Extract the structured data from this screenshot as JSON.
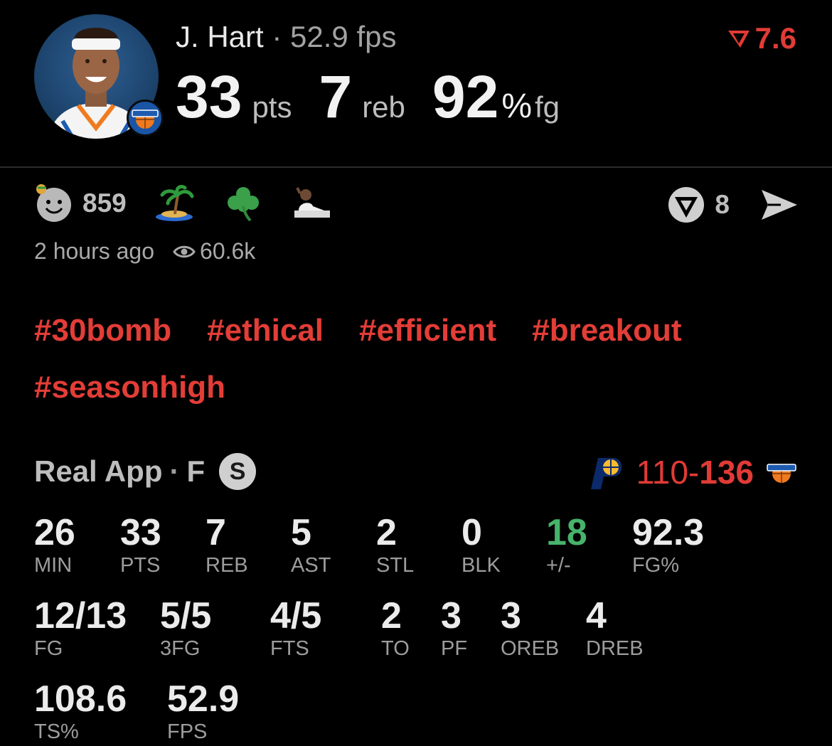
{
  "header": {
    "player_name": "J. Hart",
    "separator": "·",
    "fps_text": "52.9 fps",
    "rating": "7.6",
    "headline": [
      {
        "value": "33",
        "unit": "pts"
      },
      {
        "value": "7",
        "unit": "reb"
      },
      {
        "value": "92",
        "pct": "%",
        "unit": "fg"
      }
    ]
  },
  "reactions": {
    "count": "859",
    "comment_count": "8"
  },
  "meta": {
    "time_ago": "2 hours ago",
    "views": "60.6k"
  },
  "tags": [
    "#30bomb",
    "#ethical",
    "#efficient",
    "#breakout",
    "#seasonhigh"
  ],
  "game": {
    "source": "Real App",
    "dot": "·",
    "status": "F",
    "badge": "S",
    "away_score": "110",
    "dash": "-",
    "home_score": "136"
  },
  "stats": {
    "row1": [
      {
        "value": "26",
        "label": "MIN"
      },
      {
        "value": "33",
        "label": "PTS"
      },
      {
        "value": "7",
        "label": "REB"
      },
      {
        "value": "5",
        "label": "AST"
      },
      {
        "value": "2",
        "label": "STL"
      },
      {
        "value": "0",
        "label": "BLK"
      },
      {
        "value": "18",
        "label": "+/-"
      },
      {
        "value": "92.3",
        "label": "FG%"
      }
    ],
    "row2": [
      {
        "value": "12/13",
        "label": "FG"
      },
      {
        "value": "5/5",
        "label": "3FG"
      },
      {
        "value": "4/5",
        "label": "FTS"
      },
      {
        "value": "2",
        "label": "TO"
      },
      {
        "value": "3",
        "label": "PF"
      },
      {
        "value": "3",
        "label": "OREB"
      },
      {
        "value": "4",
        "label": "DREB"
      }
    ],
    "row3": [
      {
        "value": "108.6",
        "label": "TS%"
      },
      {
        "value": "52.9",
        "label": "FPS"
      }
    ]
  },
  "colors": {
    "accent_red": "#e13b36",
    "positive_green": "#47b36b"
  },
  "icons": [
    "player-avatar",
    "knicks-logo-icon",
    "face-emoji-icon",
    "island-emoji-icon",
    "shamrock-emoji-icon",
    "player-emoji-icon",
    "comment-icon",
    "send-icon",
    "eye-icon",
    "pacers-logo-icon",
    "rating-icon"
  ]
}
